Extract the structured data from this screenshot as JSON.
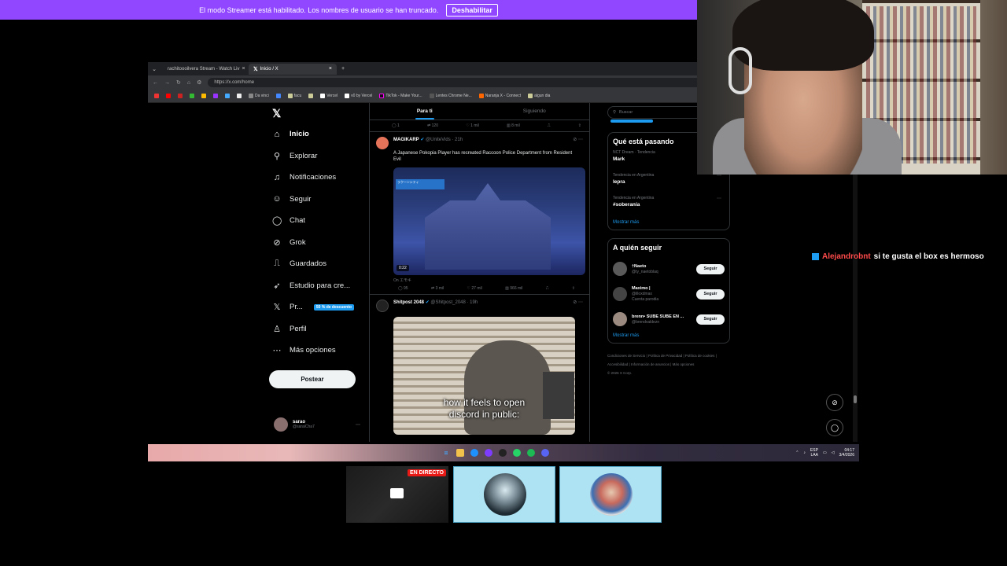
{
  "banner": {
    "text": "El modo Streamer está habilitado. Los nombres de usuario se han truncado.",
    "button": "Deshabilitar"
  },
  "browser": {
    "tabs": [
      {
        "label": "rachitoooilvera Stream - Watch Liv",
        "active": false
      },
      {
        "label": "Inicio / X",
        "active": true
      }
    ],
    "url": "https://x.com/home",
    "bookmarks": [
      "Da vinci",
      "facu",
      "Vercel",
      "v0 by Vercel",
      "TikTok - Make Your...",
      "Lentes Chrome Ne...",
      "Naranja X - Connect",
      "algun dia"
    ]
  },
  "nav": {
    "items": [
      {
        "label": "Inicio",
        "icon": "home-icon"
      },
      {
        "label": "Explorar",
        "icon": "search-icon"
      },
      {
        "label": "Notificaciones",
        "icon": "bell-icon"
      },
      {
        "label": "Seguir",
        "icon": "people-icon"
      },
      {
        "label": "Chat",
        "icon": "chat-icon"
      },
      {
        "label": "Grok",
        "icon": "grok-icon"
      },
      {
        "label": "Guardados",
        "icon": "bookmark-icon"
      },
      {
        "label": "Estudio para cre...",
        "icon": "rocket-icon"
      },
      {
        "label": "Pr...",
        "icon": "x-icon"
      },
      {
        "label": "Perfil",
        "icon": "person-icon"
      },
      {
        "label": "Más opciones",
        "icon": "more-icon"
      }
    ],
    "promo": "50 % de descuento",
    "post_button": "Postear",
    "account_name": "sarao",
    "account_handle": "@saraiCha7"
  },
  "feed": {
    "tabs": [
      "Para ti",
      "Siguiendo"
    ],
    "top_actions": [
      "1",
      "120",
      "1 mil",
      "8 mil"
    ],
    "tweet1": {
      "name": "MAGIKARP",
      "handle": "@UniteVids · 21h",
      "text": "A Japanese Pokopia Player has recreated Raccoon Police Department from Resident Evil",
      "duration": "0:22",
      "video_label": "ラクーンシティ",
      "under_media": "On エモキ",
      "actions": [
        "95",
        "3 mil",
        "27 mil",
        "966 mil"
      ]
    },
    "tweet2": {
      "name": "Shitpost 2048",
      "handle": "@Shitpost_2048 · 19h",
      "caption_line1": "how it feels to open",
      "caption_line2": "discord in public:"
    }
  },
  "right": {
    "search_placeholder": "Buscar",
    "trends_title": "Qué está pasando",
    "trends": [
      {
        "meta": "NCT Dream · Tendencia",
        "name": "Mark"
      },
      {
        "meta": "Tendencia en Argentina",
        "name": "lepra"
      },
      {
        "meta": "Tendencia en Argentina",
        "name": "#soberanía"
      }
    ],
    "show_more": "Mostrar más",
    "follow_title": "A quién seguir",
    "follows": [
      {
        "name": "†Naeto",
        "handle": "@ty_naetoblaq",
        "button": "Seguir"
      },
      {
        "name": "Maximo |",
        "handle": "@illoxdmax",
        "extra": "Cuenta parodia",
        "button": "Seguir"
      },
      {
        "name": "brenn• SUBE SUBE EN ...",
        "handle": "@brendvaldezn",
        "button": "Seguir"
      }
    ],
    "show_more2": "Mostrar más",
    "footer": [
      "Condiciones de Servicio",
      "Política de Privacidad",
      "Política de cookies",
      "Accesibilidad",
      "Información de anuncios",
      "Más opciones",
      "© 2026 X Corp."
    ]
  },
  "taskbar": {
    "lang1": "ESP",
    "lang2": "LAA",
    "time": "04:17",
    "date": "3/4/2026"
  },
  "chat": {
    "user": "Alejandrobnt",
    "message": "si te gusta el box es hermoso"
  },
  "thumbs": {
    "live": "EN DIRECTO"
  },
  "colors": {
    "banner": "#9147ff",
    "x_blue": "#1d9bf0",
    "live_red": "#e91916"
  }
}
